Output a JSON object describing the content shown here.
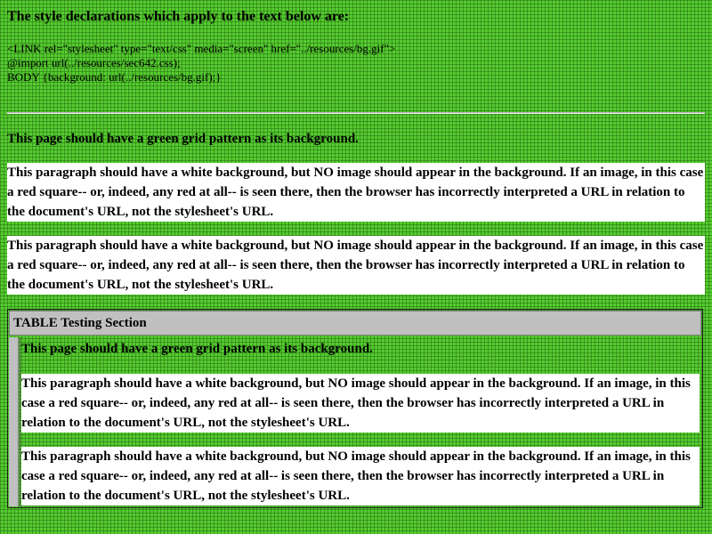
{
  "header": {
    "title": "The style declarations which apply to the text below are:"
  },
  "code": {
    "lines": [
      "<LINK rel=\"stylesheet\" type=\"text/css\" media=\"screen\" href=\"../resources/bg.gif\">",
      "@import url(../resources/sec642.css);",
      "BODY {background: url(../resources/bg.gif);}"
    ]
  },
  "main": {
    "green_note": "This page should have a green grid pattern as its background.",
    "paragraphs": [
      "This paragraph should have a white background, but NO image should appear in the background. If an image, in this case a red square-- or, indeed, any red at all-- is seen there, then the browser has incorrectly interpreted a URL in relation to the document's URL, not the stylesheet's URL.",
      "This paragraph should have a white background, but NO image should appear in the background. If an image, in this case a red square-- or, indeed, any red at all-- is seen there, then the browser has incorrectly interpreted a URL in relation to the document's URL, not the stylesheet's URL."
    ]
  },
  "table_section": {
    "header": "TABLE Testing Section",
    "green_note": "This page should have a green grid pattern as its background.",
    "paragraphs": [
      "This paragraph should have a white background, but NO image should appear in the background. If an image, in this case a red square-- or, indeed, any red at all-- is seen there, then the browser has incorrectly interpreted a URL in relation to the document's URL, not the stylesheet's URL.",
      "This paragraph should have a white background, but NO image should appear in the background. If an image, in this case a red square-- or, indeed, any red at all-- is seen there, then the browser has incorrectly interpreted a URL in relation to the document's URL, not the stylesheet's URL."
    ]
  },
  "colors": {
    "page_background": "#55cc2f",
    "grid_lines": "#286e14",
    "paragraph_background": "#ffffff",
    "table_header_background": "#c0c0c0"
  }
}
